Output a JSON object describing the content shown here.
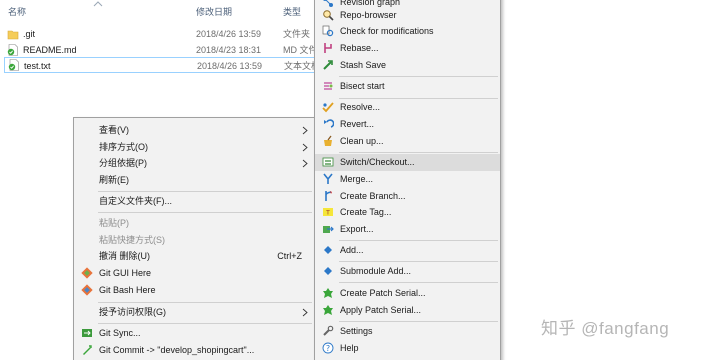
{
  "columns": {
    "name": "名称",
    "date": "修改日期",
    "type": "类型"
  },
  "files": [
    {
      "name": ".git",
      "date": "2018/4/26 13:59",
      "type": "文件夹",
      "icon": "folder-icon"
    },
    {
      "name": "README.md",
      "date": "2018/4/23 18:31",
      "type": "MD 文件",
      "icon": "git-clean-file-icon"
    },
    {
      "name": "test.txt",
      "date": "2018/4/26 13:59",
      "type": "文本文档",
      "icon": "git-clean-file-icon"
    }
  ],
  "shell_menu": {
    "view": "查看(V)",
    "sort_by": "排序方式(O)",
    "group_by": "分组依据(P)",
    "refresh": "刷新(E)",
    "customize_folder": "自定义文件夹(F)...",
    "paste": "粘贴(P)",
    "paste_shortcut": "粘贴快捷方式(S)",
    "undo_delete": "撤消 删除(U)",
    "undo_shortcut": "Ctrl+Z",
    "git_gui": "Git GUI Here",
    "git_bash": "Git Bash Here",
    "grant_access": "授予访问权限(G)",
    "git_sync": "Git Sync...",
    "git_commit": "Git Commit -> \"develop_shopingcart\"..."
  },
  "tgit_menu": {
    "revision_graph": "Revision graph",
    "repo_browser": "Repo-browser",
    "check_modifications": "Check for modifications",
    "rebase": "Rebase...",
    "stash_save": "Stash Save",
    "bisect_start": "Bisect start",
    "resolve": "Resolve...",
    "revert": "Revert...",
    "clean_up": "Clean up...",
    "switch_checkout": "Switch/Checkout...",
    "merge": "Merge...",
    "create_branch": "Create Branch...",
    "create_tag": "Create Tag...",
    "export": "Export...",
    "add": "Add...",
    "submodule_add": "Submodule Add...",
    "create_patch_serial": "Create Patch Serial...",
    "apply_patch_serial": "Apply Patch Serial...",
    "settings": "Settings",
    "help": "Help"
  },
  "watermark": "知乎 @fangfang",
  "colors": {
    "accent_blue": "#1e73d6",
    "selection_border": "#99d1ff",
    "menu_bg": "#f2f2f2",
    "highlight": "#dcdcdc"
  }
}
